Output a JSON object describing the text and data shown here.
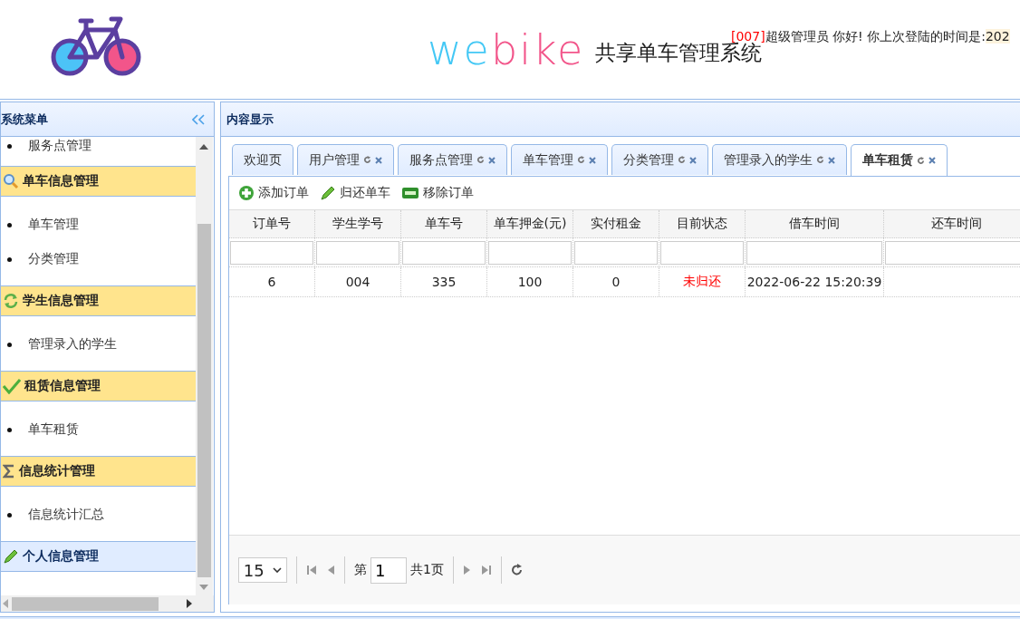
{
  "header": {
    "logo_parts": [
      {
        "text": "we",
        "color": "#44c8f5"
      },
      {
        "text": "bike",
        "color": "#f2558a"
      }
    ],
    "subtitle": "共享单车管理系统",
    "greeting": {
      "user_id": "[007]",
      "text": "超级管理员 你好! 你上次登陆的时间是:",
      "time": "202"
    }
  },
  "sidebar": {
    "title": "系统菜单",
    "top_item": "服务点管理",
    "groups": [
      {
        "title": "单车信息管理",
        "expanded": true,
        "items": [
          "单车管理",
          "分类管理"
        ]
      },
      {
        "title": "学生信息管理",
        "expanded": true,
        "items": [
          "管理录入的学生"
        ]
      },
      {
        "title": "租赁信息管理",
        "expanded": true,
        "items": [
          "单车租赁"
        ]
      },
      {
        "title": "信息统计管理",
        "expanded": true,
        "items": [
          "信息统计汇总"
        ]
      },
      {
        "title": "个人信息管理",
        "expanded": false
      }
    ]
  },
  "content": {
    "title": "内容显示",
    "tabs": [
      {
        "label": "欢迎页",
        "selected": false,
        "closable": false
      },
      {
        "label": "用户管理",
        "selected": false,
        "closable": true
      },
      {
        "label": "服务点管理",
        "selected": false,
        "closable": true
      },
      {
        "label": "单车管理",
        "selected": false,
        "closable": true
      },
      {
        "label": "分类管理",
        "selected": false,
        "closable": true
      },
      {
        "label": "管理录入的学生",
        "selected": false,
        "closable": true
      },
      {
        "label": "单车租赁",
        "selected": true,
        "closable": true
      }
    ],
    "toolbar": [
      "添加订单",
      "归还单车",
      "移除订单"
    ],
    "table": {
      "columns": [
        {
          "label": "订单号",
          "kind": "text"
        },
        {
          "label": "学生学号",
          "kind": "text"
        },
        {
          "label": "单车号",
          "kind": "text"
        },
        {
          "label": "单车押金(元)",
          "kind": "text"
        },
        {
          "label": "实付租金",
          "kind": "text"
        },
        {
          "label": "目前状态",
          "kind": "status"
        },
        {
          "label": "借车时间",
          "kind": "text"
        },
        {
          "label": "还车时间",
          "kind": "text"
        }
      ],
      "rows": [
        [
          "6",
          "004",
          "335",
          "100",
          "0",
          "未归还",
          "2022-06-22 15:20:39",
          ""
        ]
      ]
    },
    "pager": {
      "page_size": "15",
      "page_label": "第",
      "page": "1",
      "total": "共1页"
    }
  }
}
